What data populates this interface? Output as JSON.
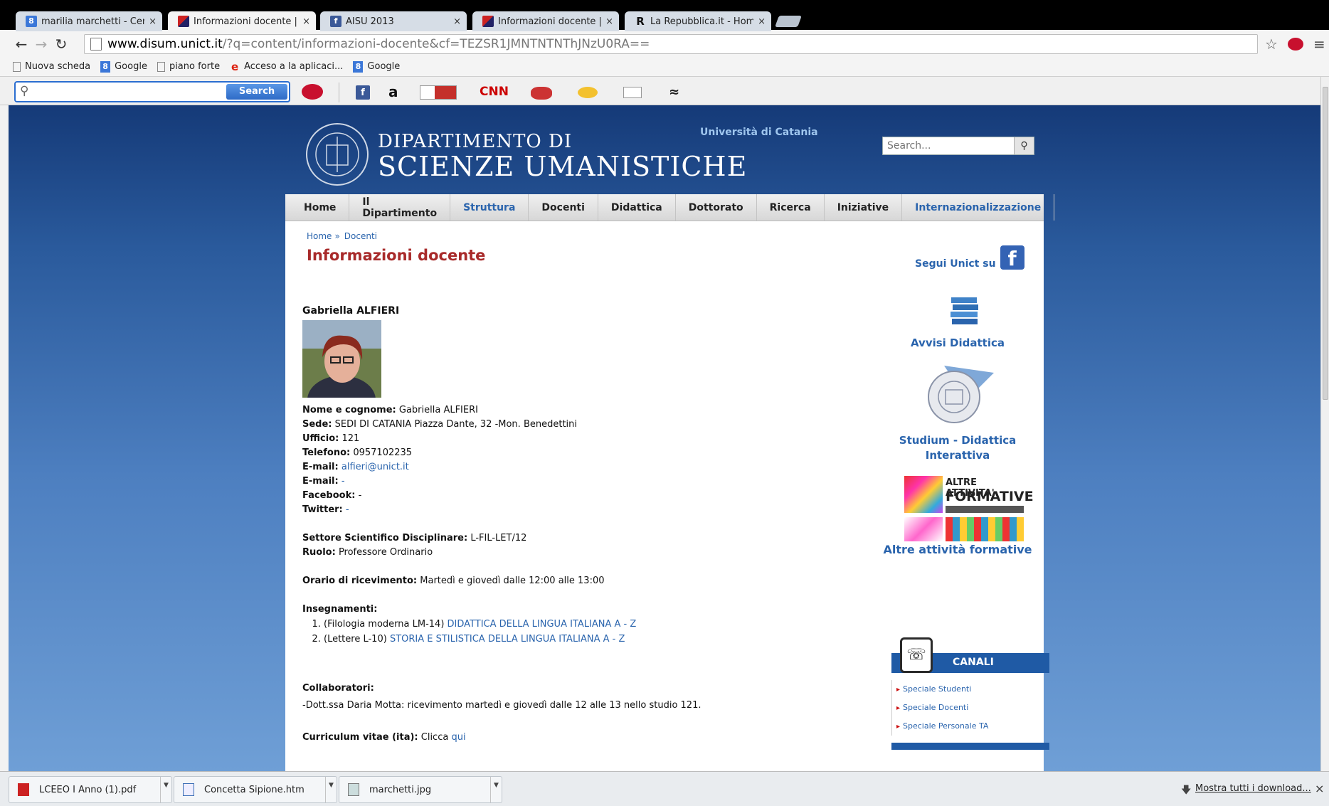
{
  "browser": {
    "tabs": [
      {
        "title": "marilia marchetti - Cerca c",
        "icon": "google-icon"
      },
      {
        "title": "Informazioni docente | ww",
        "icon": "unict-icon",
        "active": true
      },
      {
        "title": "AISU 2013",
        "icon": "facebook-icon"
      },
      {
        "title": "Informazioni docente | ww",
        "icon": "unict-icon"
      },
      {
        "title": "La Repubblica.it - Homepa",
        "icon": "repubblica-icon"
      }
    ],
    "close_glyph": "×",
    "url_host": "www.disum.unict.it",
    "url_rest": "/?q=content/informazioni-docente&cf=TEZSR1JMNTNTNThJNzU0RA==",
    "bookmarks": [
      "Nuova scheda",
      "Google",
      "piano forte",
      "Acceso a la aplicaci...",
      "Google"
    ],
    "ask_toolbar": {
      "search_button": "Search",
      "search_value": ""
    }
  },
  "site": {
    "dept_line1": "DIPARTIMENTO DI",
    "dept_line2": "SCIENZE UMANISTICHE",
    "university": "Università di Catania",
    "search_placeholder": "Search...",
    "nav": [
      "Home",
      "Il Dipartimento",
      "Struttura",
      "Docenti",
      "Didattica",
      "Dottorato",
      "Ricerca",
      "Iniziative",
      "Internazionalizzazione"
    ],
    "breadcrumb": {
      "home": "Home",
      "sep": "»",
      "docenti": "Docenti"
    },
    "page_title": "Informazioni docente"
  },
  "docente": {
    "name": "Gabriella ALFIERI",
    "fields": {
      "nome_label": "Nome e cognome:",
      "nome": "Gabriella ALFIERI",
      "sede_label": "Sede:",
      "sede": "SEDI DI CATANIA Piazza Dante, 32 -Mon. Benedettini",
      "ufficio_label": "Ufficio:",
      "ufficio": "121",
      "telefono_label": "Telefono:",
      "telefono": "0957102235",
      "email1_label": "E-mail:",
      "email1": "alfieri@unict.it",
      "email2_label": "E-mail:",
      "email2": "-",
      "facebook_label": "Facebook:",
      "facebook": "-",
      "twitter_label": "Twitter:",
      "twitter": "-",
      "ssd_label": "Settore Scientifico Disciplinare:",
      "ssd": "L-FIL-LET/12",
      "ruolo_label": "Ruolo:",
      "ruolo": "Professore Ordinario",
      "orario_label": "Orario di ricevimento:",
      "orario": "Martedì e giovedì dalle 12:00 alle 13:00",
      "insegnamenti_label": "Insegnamenti:",
      "collaboratori_label": "Collaboratori:",
      "collaboratori": "-Dott.ssa Daria Motta: ricevimento martedì e giovedì dalle 12 alle 13 nello studio 121.",
      "cv_label": "Curriculum vitae (ita):",
      "cv_text": "Clicca",
      "cv_link": "qui"
    },
    "insegnamenti": [
      {
        "corso": "(Filologia moderna LM-14)",
        "titolo": "DIDATTICA DELLA LINGUA ITALIANA A - Z"
      },
      {
        "corso": "(Lettere L-10)",
        "titolo": "STORIA E STILISTICA DELLA LINGUA ITALIANA A - Z"
      }
    ]
  },
  "sidebar": {
    "segui": "Segui Unict su",
    "avvisi": "Avvisi Didattica",
    "studium": "Studium - Didattica Interattiva",
    "altre_banner_1": "ALTRE ATTIVITA'",
    "altre_banner_2": "FORMATIVE",
    "altre": "Altre attività formative",
    "canali_title": "CANALI",
    "canali": [
      "Speciale Studenti",
      "Speciale Docenti",
      "Speciale Personale TA"
    ]
  },
  "downloads": {
    "items": [
      "LCEEO I Anno (1).pdf",
      "Concetta Sipione.htm",
      "marchetti.jpg"
    ],
    "show_all": "Mostra tutti i download..."
  }
}
